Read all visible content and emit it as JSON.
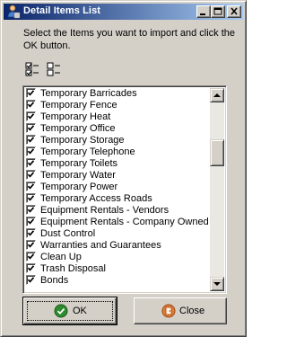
{
  "window": {
    "title": "Detail Items List",
    "controls": [
      "minimize-icon",
      "maximize-icon",
      "close-icon"
    ]
  },
  "instruction": "Select the Items you want to import and click the OK button.",
  "toolbar": {
    "icons": [
      "select-all-icon",
      "deselect-all-icon"
    ]
  },
  "items": [
    {
      "label": "Temporary Barricades",
      "checked": true
    },
    {
      "label": "Temporary Fence",
      "checked": true
    },
    {
      "label": "Temporary Heat",
      "checked": true
    },
    {
      "label": "Temporary Office",
      "checked": true
    },
    {
      "label": "Temporary Storage",
      "checked": true
    },
    {
      "label": "Temporary Telephone",
      "checked": true
    },
    {
      "label": "Temporary Toilets",
      "checked": true
    },
    {
      "label": "Temporary Water",
      "checked": true
    },
    {
      "label": "Temporary Power",
      "checked": true
    },
    {
      "label": "Temporary Access Roads",
      "checked": true
    },
    {
      "label": "Equipment Rentals - Vendors",
      "checked": true
    },
    {
      "label": "Equipment Rentals - Company Owned",
      "checked": true
    },
    {
      "label": "Dust Control",
      "checked": true
    },
    {
      "label": "Warranties and Guarantees",
      "checked": true
    },
    {
      "label": "Clean Up",
      "checked": true
    },
    {
      "label": "Trash Disposal",
      "checked": true
    },
    {
      "label": "Bonds",
      "checked": true
    }
  ],
  "scrollbar": {
    "position": 0.25
  },
  "buttons": {
    "ok_label": "OK",
    "close_label": "Close"
  },
  "colors": {
    "titlebar_start": "#0a246a",
    "titlebar_end": "#a6caf0",
    "face": "#d4d0c8",
    "ok_icon": "#2e8b2e",
    "close_icon": "#e07b39"
  }
}
